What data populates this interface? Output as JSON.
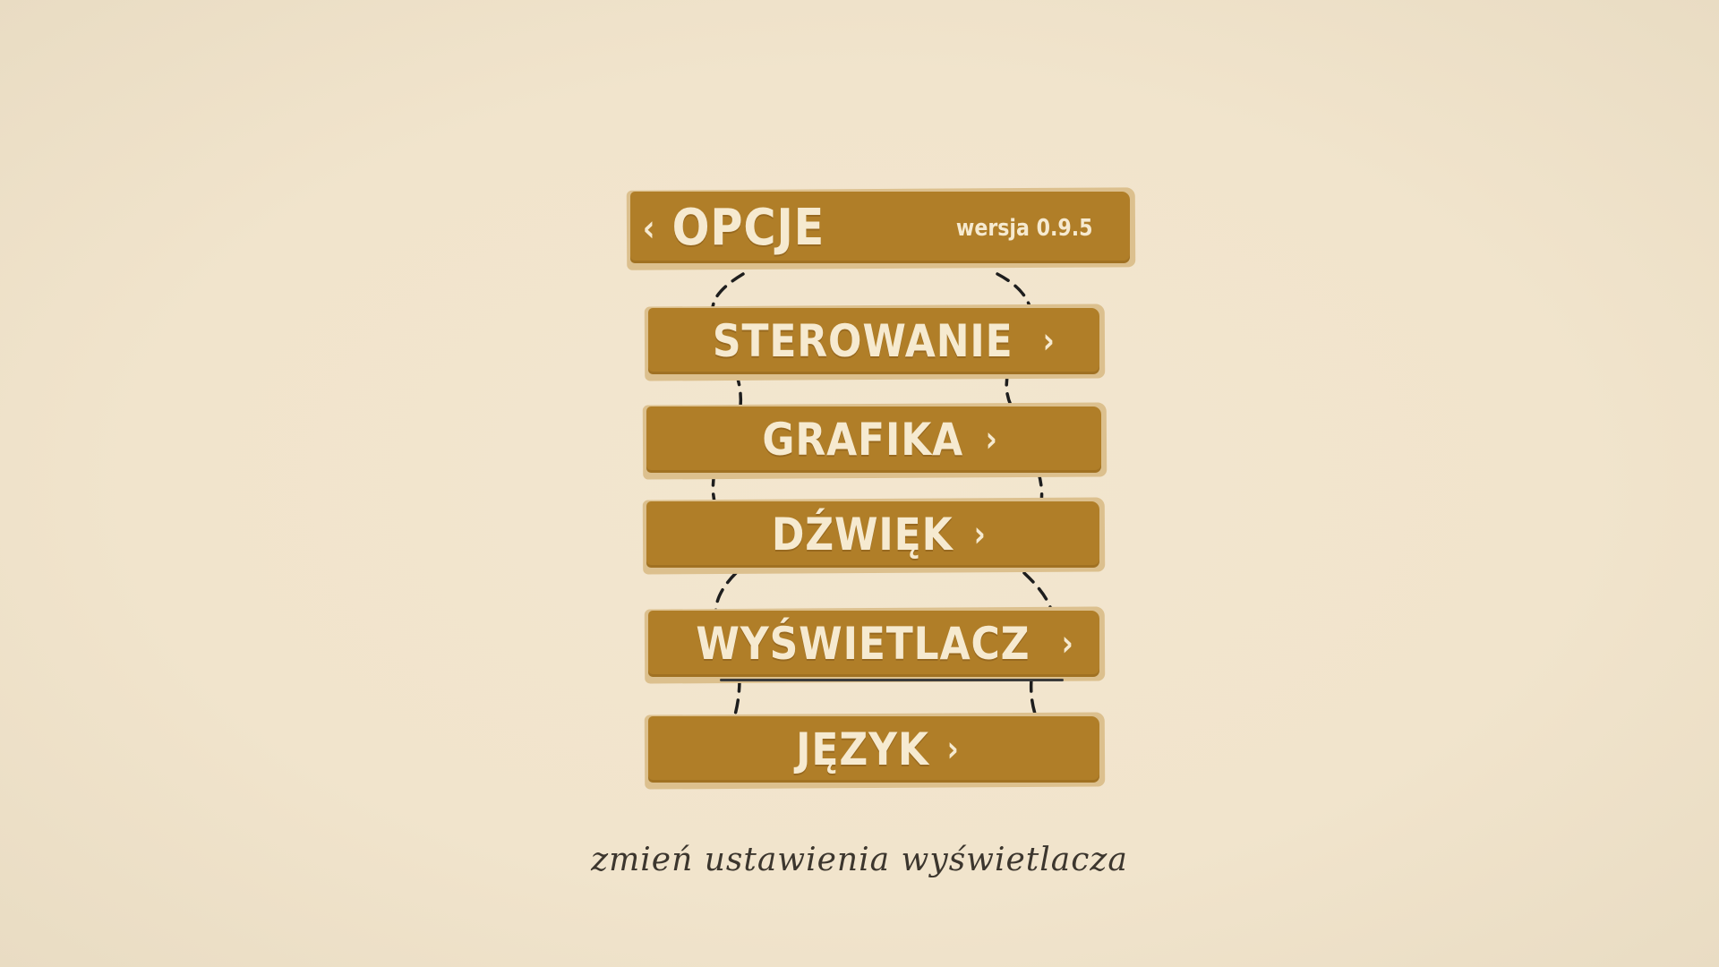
{
  "header": {
    "back_icon": "chevron-left-icon",
    "title": "OPCJE",
    "version": "wersja 0.9.5"
  },
  "menu": {
    "items": [
      {
        "label": "STEROWANIE",
        "icon": "chevron-right-icon"
      },
      {
        "label": "GRAFIKA",
        "icon": "chevron-right-icon"
      },
      {
        "label": "DŹWIĘK",
        "icon": "chevron-right-icon"
      },
      {
        "label": "WYŚWIETLACZ",
        "icon": "chevron-right-icon"
      },
      {
        "label": "JĘZYK",
        "icon": "chevron-right-icon"
      }
    ]
  },
  "hint": "zmień ustawienia wyświetlacza",
  "colors": {
    "background": "#f1e4cc",
    "plank": "#b07e28",
    "plank_shadow": "#dcc08e",
    "text_light": "#f6ead0",
    "text_dark": "#3c362e",
    "rope": "#1e1e1e"
  }
}
